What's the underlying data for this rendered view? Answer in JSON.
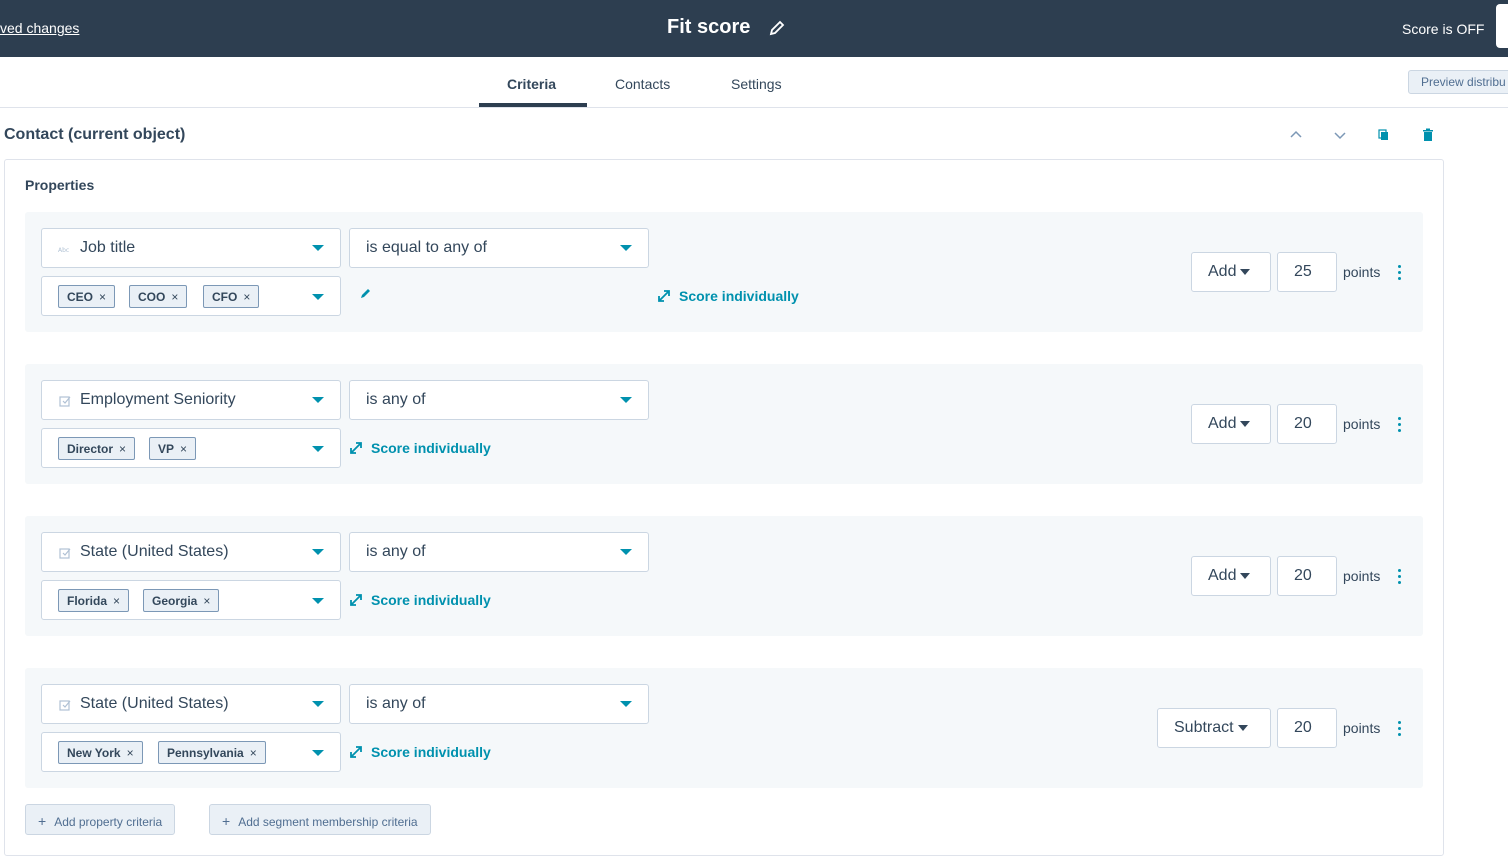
{
  "header": {
    "unsaved_label": "ved changes",
    "title": "Fit score",
    "score_status": "Score is OFF"
  },
  "tabs": [
    {
      "label": "Criteria",
      "active": true
    },
    {
      "label": "Contacts",
      "active": false
    },
    {
      "label": "Settings",
      "active": false
    }
  ],
  "preview_button": "Preview distribu",
  "section": {
    "title": "Contact (current object)",
    "panel_title": "Properties"
  },
  "rules": [
    {
      "property": "Job title",
      "operator": "is equal to any of",
      "values": [
        "CEO",
        "COO",
        "CFO"
      ],
      "score_individually": "Score individually",
      "action": "Add",
      "points": "25",
      "points_label": "points"
    },
    {
      "property": "Employment Seniority",
      "operator": "is any of",
      "values": [
        "Director",
        "VP"
      ],
      "score_individually": "Score individually",
      "action": "Add",
      "points": "20",
      "points_label": "points"
    },
    {
      "property": "State (United States)",
      "operator": "is any of",
      "values": [
        "Florida",
        "Georgia"
      ],
      "score_individually": "Score individually",
      "action": "Add",
      "points": "20",
      "points_label": "points"
    },
    {
      "property": "State (United States)",
      "operator": "is any of",
      "values": [
        "New York",
        "Pennsylvania"
      ],
      "score_individually": "Score individually",
      "action": "Subtract",
      "points": "20",
      "points_label": "points"
    }
  ],
  "buttons": {
    "add_property": "Add property criteria",
    "add_segment": "Add segment membership criteria"
  },
  "colors": {
    "header_bg": "#2d3e50",
    "accent": "#0091ae",
    "row_bg": "#f5f8fa"
  }
}
